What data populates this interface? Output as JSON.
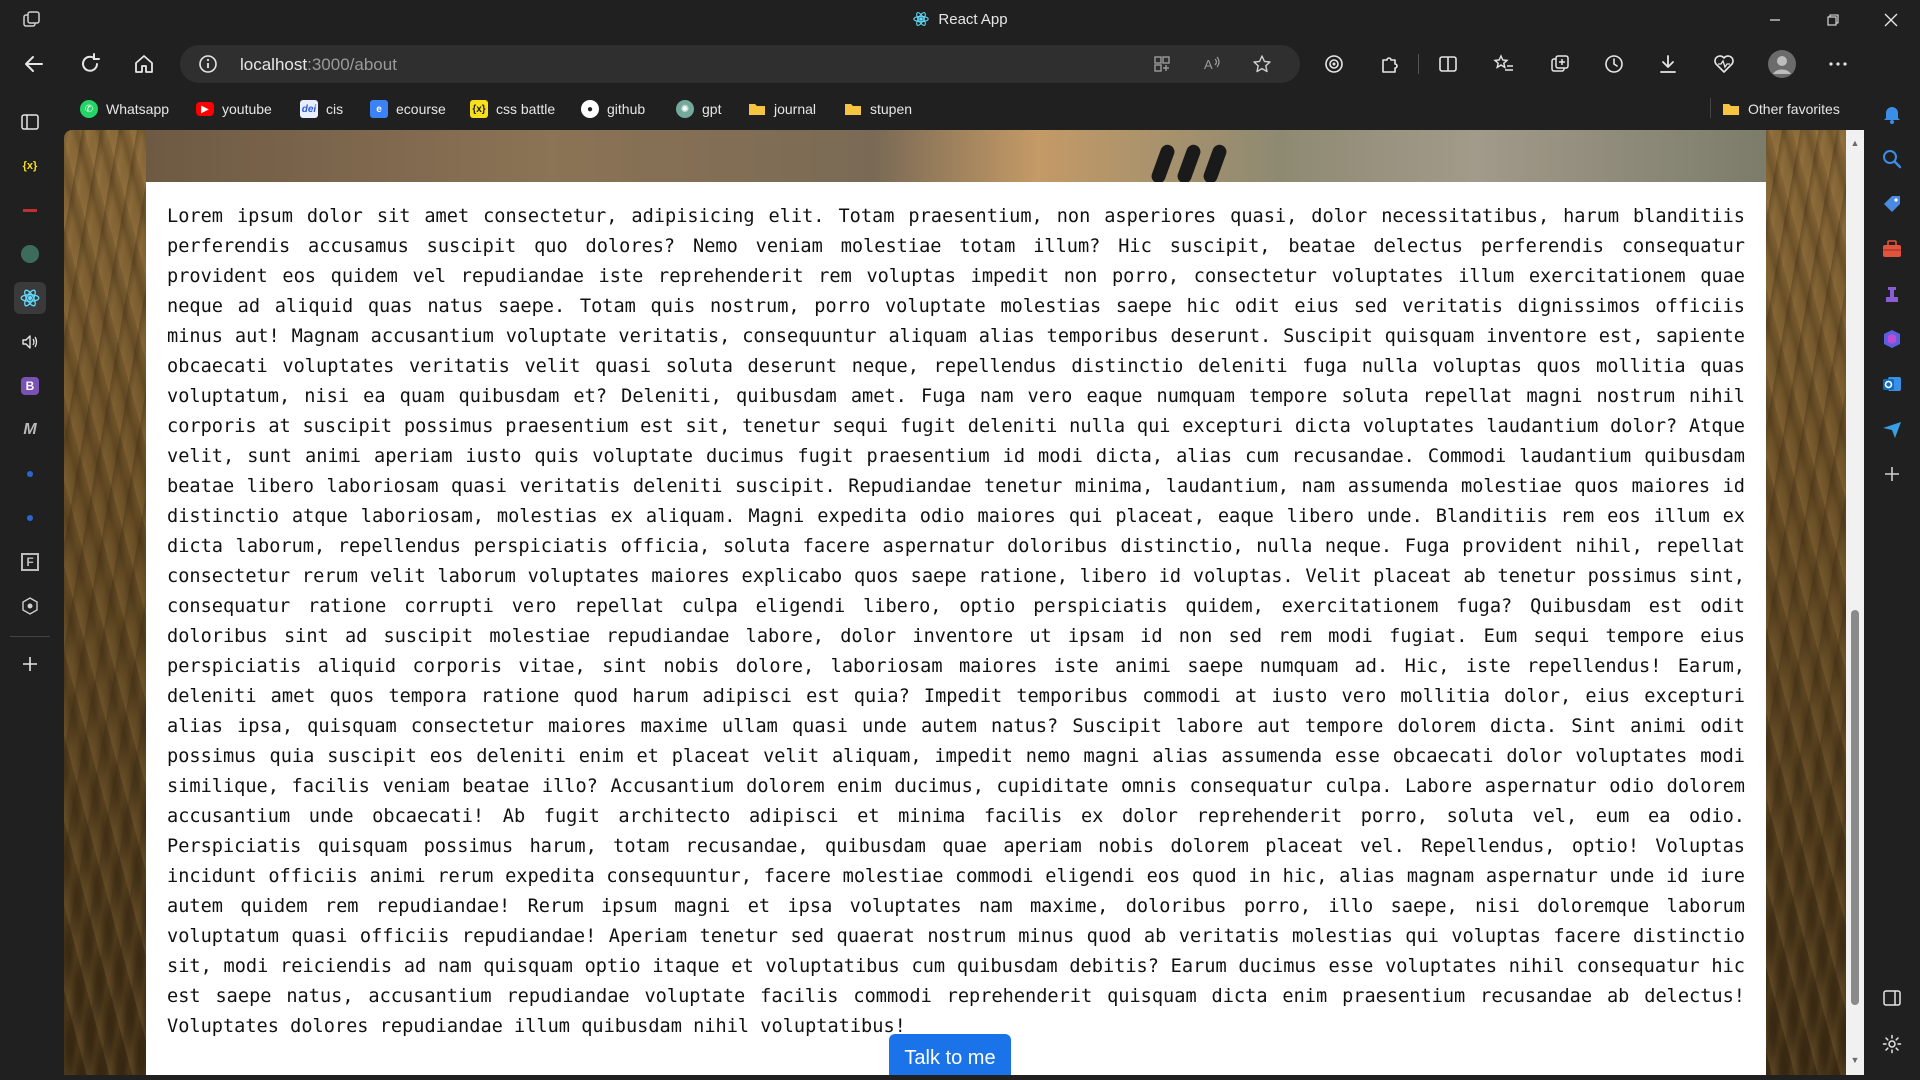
{
  "window": {
    "title": "React App",
    "controls": [
      "minimize",
      "restore",
      "close"
    ]
  },
  "toolbar": {
    "url_host": "localhost",
    "url_path": ":3000/about"
  },
  "favorites": [
    {
      "label": "Whatsapp",
      "icon": "whatsapp-icon",
      "color": "#25d366"
    },
    {
      "label": "youtube",
      "icon": "youtube-icon",
      "color": "#ff0000"
    },
    {
      "label": "cis",
      "icon": "cis-icon",
      "color": "#2a5bd7"
    },
    {
      "label": "ecourse",
      "icon": "ecourse-icon",
      "color": "#3b82f6"
    },
    {
      "label": "css battle",
      "icon": "css-battle-icon",
      "color": "#f7df1e"
    },
    {
      "label": "github",
      "icon": "github-icon",
      "color": "#ffffff"
    },
    {
      "label": "gpt",
      "icon": "gpt-icon",
      "color": "#74aa9c"
    },
    {
      "label": "journal",
      "icon": "folder-icon",
      "color": "#f5c542"
    },
    {
      "label": "stupen",
      "icon": "folder-icon",
      "color": "#f5c542"
    }
  ],
  "other_favorites": "Other favorites",
  "page": {
    "lorem": "Lorem ipsum dolor sit amet consectetur, adipisicing elit. Totam praesentium, non asperiores quasi, dolor necessitatibus, harum blanditiis perferendis accusamus suscipit quo dolores? Nemo veniam molestiae totam illum? Hic suscipit, beatae delectus perferendis consequatur provident eos quidem vel repudiandae iste reprehenderit rem voluptas impedit non porro, consectetur voluptates illum exercitationem quae neque ad aliquid quas natus saepe. Totam quis nostrum, porro voluptate molestias saepe hic odit eius sed veritatis dignissimos officiis minus aut! Magnam accusantium voluptate veritatis, consequuntur aliquam alias temporibus deserunt. Suscipit quisquam inventore est, sapiente obcaecati voluptates veritatis velit quasi soluta deserunt neque, repellendus distinctio deleniti fuga nulla voluptas quos mollitia quas voluptatum, nisi ea quam quibusdam et? Deleniti, quibusdam amet. Fuga nam vero eaque numquam tempore soluta repellat magni nostrum nihil corporis at suscipit possimus praesentium est sit, tenetur sequi fugit deleniti nulla qui excepturi dicta voluptates laudantium dolor? Atque velit, sunt animi aperiam iusto quis voluptate ducimus fugit praesentium id modi dicta, alias cum recusandae. Commodi laudantium quibusdam beatae libero laboriosam quasi veritatis deleniti suscipit. Repudiandae tenetur minima, laudantium, nam assumenda molestiae quos maiores id distinctio atque laboriosam, molestias ex aliquam. Magni expedita odio maiores qui placeat, eaque libero unde. Blanditiis rem eos illum ex dicta laborum, repellendus perspiciatis officia, soluta facere aspernatur doloribus distinctio, nulla neque. Fuga provident nihil, repellat consectetur rerum velit laborum voluptates maiores explicabo quos saepe ratione, libero id voluptas. Velit placeat ab tenetur possimus sint, consequatur ratione corrupti vero repellat culpa eligendi libero, optio perspiciatis quidem, exercitationem fuga? Quibusdam est odit doloribus sint ad suscipit molestiae repudiandae labore, dolor inventore ut ipsam id non sed rem modi fugiat. Eum sequi tempore eius perspiciatis aliquid corporis vitae, sint nobis dolore, laboriosam maiores iste animi saepe numquam ad. Hic, iste repellendus! Earum, deleniti amet quos tempora ratione quod harum adipisci est quia? Impedit temporibus commodi at iusto vero mollitia dolor, eius excepturi alias ipsa, quisquam consectetur maiores maxime ullam quasi unde autem natus? Suscipit labore aut tempore dolorem dicta. Sint animi odit possimus quia suscipit eos deleniti enim et placeat velit aliquam, impedit nemo magni alias assumenda esse obcaecati dolor voluptates modi similique, facilis veniam beatae illo? Accusantium dolorem enim ducimus, cupiditate omnis consequatur culpa. Labore aspernatur odio dolorem accusantium unde obcaecati! Ab fugit architecto adipisci et minima facilis ex dolor reprehenderit porro, soluta vel, eum ea odio. Perspiciatis quisquam possimus harum, totam recusandae, quibusdam quae aperiam nobis dolorem placeat vel. Repellendus, optio! Voluptas incidunt officiis animi rerum expedita consequuntur, facere molestiae commodi eligendi eos quod in hic, alias magnam aspernatur unde id iure autem quidem rem repudiandae! Rerum ipsum magni et ipsa voluptates nam maxime, doloribus porro, illo saepe, nisi doloremque laborum voluptatum quasi officiis repudiandae! Aperiam tenetur sed quaerat nostrum minus quod ab veritatis molestias qui voluptas facere distinctio sit, modi reiciendis ad nam quisquam optio itaque et voluptatibus cum quibusdam debitis? Earum ducimus esse voluptates nihil consequatur hic est saepe natus, accusantium repudiandae voluptate facilis commodi reprehenderit quisquam dicta enim praesentium recusandae ab delectus! Voluptates dolores repudiandae illum quibusdam nihil voluptatibus!",
    "cta_label": "Talk to me"
  },
  "colors": {
    "chrome": "#202020",
    "addressbar": "#2f2f2f",
    "accent": "#1a73e8",
    "card": "#ffffff"
  }
}
